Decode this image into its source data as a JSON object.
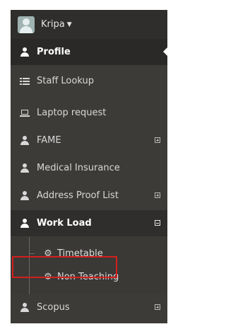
{
  "user": {
    "name": "Kripa",
    "caret_icon": "chevron-down-icon"
  },
  "menu": {
    "items": [
      {
        "label": "Profile",
        "icon": "user-icon",
        "state": "active"
      },
      {
        "label": "Staff Lookup",
        "icon": "list-icon"
      },
      {
        "label": "Laptop request",
        "icon": "laptop-icon"
      },
      {
        "label": "FAME",
        "icon": "user-icon",
        "toggle": "plus"
      },
      {
        "label": "Medical Insurance",
        "icon": "user-icon"
      },
      {
        "label": "Address Proof List",
        "icon": "user-icon",
        "toggle": "plus"
      },
      {
        "label": "Work Load",
        "icon": "user-icon",
        "toggle": "minus",
        "state": "open"
      },
      {
        "label": "Scopus",
        "icon": "user-icon",
        "toggle": "plus"
      }
    ],
    "work_load_submenu": [
      {
        "label": "Timetable",
        "icon": "gear-icon"
      },
      {
        "label": "Non Teaching",
        "icon": "gear-icon",
        "highlighted": true
      }
    ]
  },
  "colors": {
    "sidebar_bg": "#3c3b38",
    "active_bg": "#2a2927",
    "highlight_border": "#d31f1f"
  }
}
